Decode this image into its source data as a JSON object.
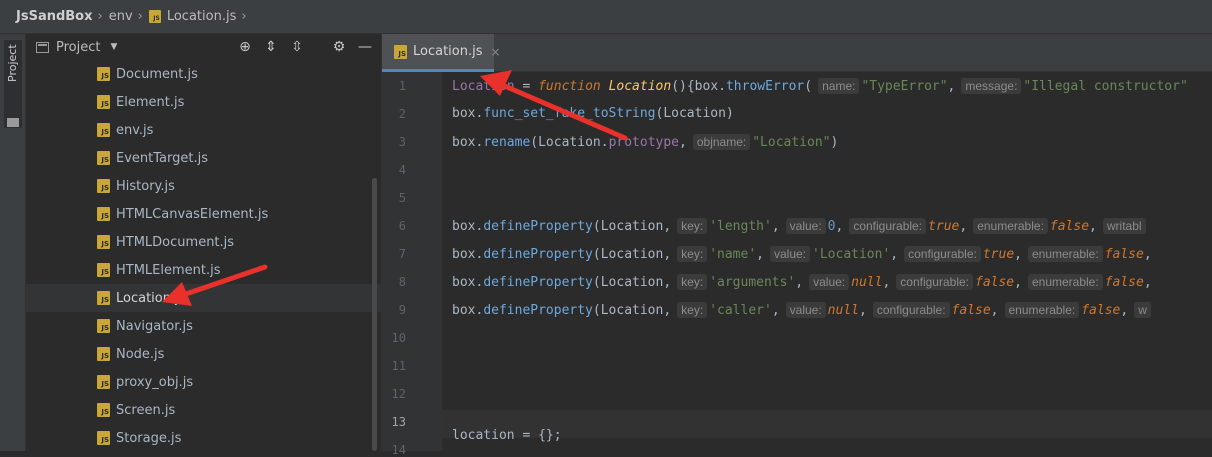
{
  "breadcrumb": {
    "project": "JsSandBox",
    "folder": "env",
    "file": "Location.js"
  },
  "sidestrip": {
    "label": "Project"
  },
  "panel": {
    "title": "Project"
  },
  "files": [
    "Document.js",
    "Element.js",
    "env.js",
    "EventTarget.js",
    "History.js",
    "HTMLCanvasElement.js",
    "HTMLDocument.js",
    "HTMLElement.js",
    "Location.js",
    "Navigator.js",
    "Node.js",
    "proxy_obj.js",
    "Screen.js",
    "Storage.js"
  ],
  "selected_file": "Location.js",
  "editor": {
    "tab_label": "Location.js",
    "line_numbers": [
      "1",
      "2",
      "3",
      "4",
      "5",
      "6",
      "7",
      "8",
      "9",
      "10",
      "11",
      "12",
      "13",
      "14"
    ],
    "current_line": "13",
    "code": {
      "l1": {
        "a": "Location",
        "b": " = ",
        "c": "function",
        "d": "Location",
        "e": "(){box.",
        "f": "throwError",
        "g": "(",
        "h1": "name:",
        "s1": "\"TypeError\"",
        "h2": "message:",
        "s2": "\"Illegal constructor\""
      },
      "l2": {
        "a": "box.",
        "b": "func_set_fake_toString",
        "c": "(Location)"
      },
      "l3": {
        "a": "box.",
        "b": "rename",
        "c": "(Location.",
        "d": "prototype",
        "e": ",",
        "h1": "objname:",
        "s1": "\"Location\"",
        "f": ")"
      },
      "l6": {
        "key": "'length'",
        "value": "0",
        "conf": "true",
        "enum": "false",
        "tail": "writabl"
      },
      "l7": {
        "key": "'name'",
        "value": "'Location'",
        "conf": "true",
        "enum": "false"
      },
      "l8": {
        "key": "'arguments'",
        "value": "null",
        "conf": "false",
        "enum": "false"
      },
      "l9": {
        "key": "'caller'",
        "value": "null",
        "conf": "false",
        "enum": "false",
        "tail": "w"
      },
      "prop": {
        "obj": "box.",
        "fn": "defineProperty",
        "open": "(Location,",
        "h_key": "key:",
        "h_value": "value:",
        "h_conf": "configurable:",
        "h_enum": "enumerable:",
        "h_writ": "writable"
      },
      "l14": {
        "a": "location = {};"
      }
    }
  }
}
